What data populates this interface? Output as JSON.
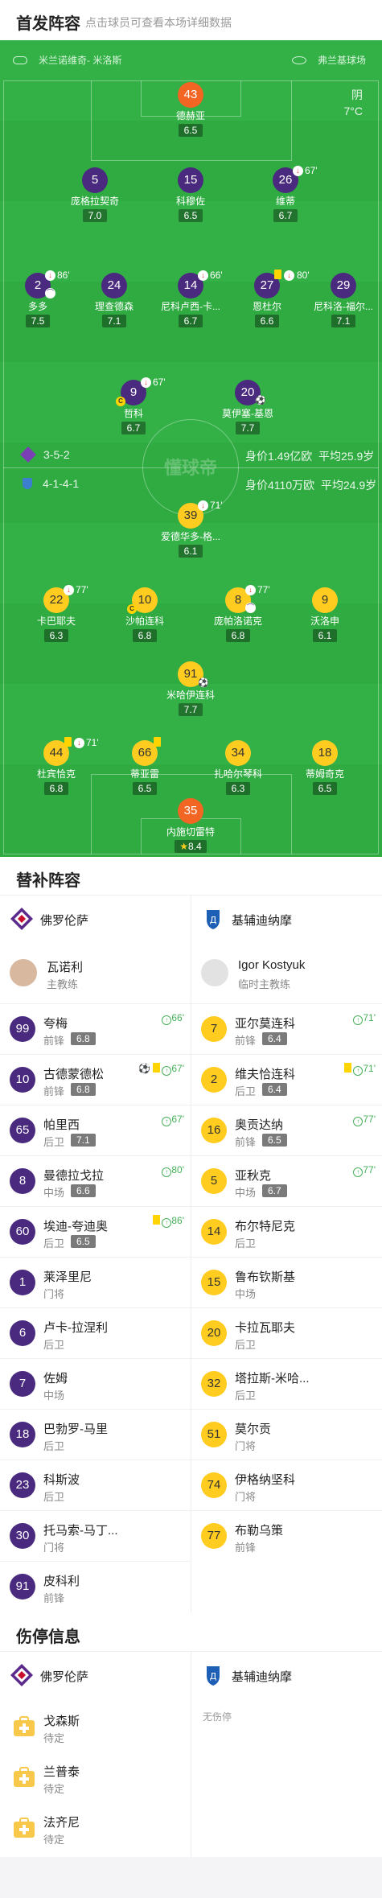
{
  "header": {
    "title": "首发阵容",
    "subtitle": "点击球员可查看本场详细数据"
  },
  "venue": {
    "home_team": "米兰诺维奇- 米洛斯",
    "stadium": "弗兰基球场"
  },
  "weather": {
    "condition": "阴",
    "temp": "7°C"
  },
  "watermark": "懂球帝",
  "home_formation": {
    "formation": "3-5-2",
    "value": "身价1.49亿欧",
    "age": "平均25.9岁"
  },
  "away_formation": {
    "formation": "4-1-4-1",
    "value": "身价4110万欧",
    "age": "平均24.9岁"
  },
  "home_players": [
    {
      "num": "43",
      "name": "德赫亚",
      "rating": "6.5",
      "gk": true
    },
    {
      "num": "5",
      "name": "庞格拉契奇",
      "rating": "7.0"
    },
    {
      "num": "15",
      "name": "科穆佐",
      "rating": "6.5"
    },
    {
      "num": "26",
      "name": "维蒂",
      "rating": "6.7",
      "sub": "67'"
    },
    {
      "num": "2",
      "name": "多多",
      "rating": "7.5",
      "sub": "86'"
    },
    {
      "num": "24",
      "name": "理查德森",
      "rating": "7.1"
    },
    {
      "num": "14",
      "name": "尼科卢西-卡...",
      "rating": "6.7",
      "sub": "66'"
    },
    {
      "num": "27",
      "name": "恩杜尔",
      "rating": "6.6",
      "sub": "80'"
    },
    {
      "num": "29",
      "name": "尼科洛-福尔...",
      "rating": "7.1"
    },
    {
      "num": "9",
      "name": "哲科",
      "rating": "6.7",
      "sub": "67'"
    },
    {
      "num": "20",
      "name": "莫伊塞-基恩",
      "rating": "7.7"
    }
  ],
  "away_players": [
    {
      "num": "39",
      "name": "爱德华多-格...",
      "rating": "6.1",
      "sub": "71'"
    },
    {
      "num": "22",
      "name": "卡巴耶夫",
      "rating": "6.3",
      "sub": "77'"
    },
    {
      "num": "10",
      "name": "沙帕连科",
      "rating": "6.8"
    },
    {
      "num": "8",
      "name": "庞帕洛诺克",
      "rating": "6.8",
      "sub": "77'"
    },
    {
      "num": "9",
      "name": "沃洛申",
      "rating": "6.1"
    },
    {
      "num": "91",
      "name": "米哈伊连科",
      "rating": "7.7"
    },
    {
      "num": "44",
      "name": "杜宾恰克",
      "rating": "6.8",
      "sub": "71'"
    },
    {
      "num": "66",
      "name": "蒂亚雷",
      "rating": "6.5"
    },
    {
      "num": "34",
      "name": "扎哈尔琴科",
      "rating": "6.3"
    },
    {
      "num": "18",
      "name": "蒂姆奇克",
      "rating": "6.5"
    },
    {
      "num": "35",
      "name": "内施切雷特",
      "rating": "8.4"
    }
  ],
  "subs_section": {
    "title": "替补阵容"
  },
  "teams": {
    "home": "佛罗伦萨",
    "away": "基辅迪纳摩"
  },
  "coaches": {
    "home": {
      "name": "瓦诺利",
      "role": "主教练"
    },
    "away": {
      "name": "Igor Kostyuk",
      "role": "临时主教练"
    }
  },
  "home_subs": [
    {
      "num": "99",
      "name": "夸梅",
      "pos": "前锋",
      "rating": "6.8",
      "event": "66'"
    },
    {
      "num": "10",
      "name": "古德蒙德松",
      "pos": "前锋",
      "rating": "6.8",
      "event": "67'"
    },
    {
      "num": "65",
      "name": "帕里西",
      "pos": "后卫",
      "rating": "7.1",
      "event": "67'"
    },
    {
      "num": "8",
      "name": "曼德拉戈拉",
      "pos": "中场",
      "rating": "6.6",
      "event": "80'"
    },
    {
      "num": "60",
      "name": "埃迪-夸迪奥",
      "pos": "后卫",
      "rating": "6.5",
      "event": "86'"
    },
    {
      "num": "1",
      "name": "莱泽里尼",
      "pos": "门将"
    },
    {
      "num": "6",
      "name": "卢卡-拉涅利",
      "pos": "后卫"
    },
    {
      "num": "7",
      "name": "佐姆",
      "pos": "中场"
    },
    {
      "num": "18",
      "name": "巴勃罗-马里",
      "pos": "后卫"
    },
    {
      "num": "23",
      "name": "科斯波",
      "pos": "后卫"
    },
    {
      "num": "30",
      "name": "托马索-马丁...",
      "pos": "门将"
    },
    {
      "num": "91",
      "name": "皮科利",
      "pos": "前锋"
    }
  ],
  "away_subs": [
    {
      "num": "7",
      "name": "亚尔莫连科",
      "pos": "前锋",
      "rating": "6.4",
      "event": "71'"
    },
    {
      "num": "2",
      "name": "维夫恰连科",
      "pos": "后卫",
      "rating": "6.4",
      "event": "71'"
    },
    {
      "num": "16",
      "name": "奥贡达纳",
      "pos": "前锋",
      "rating": "6.5",
      "event": "77'"
    },
    {
      "num": "5",
      "name": "亚秋克",
      "pos": "中场",
      "rating": "6.7",
      "event": "77'"
    },
    {
      "num": "14",
      "name": "布尔特尼克",
      "pos": "后卫"
    },
    {
      "num": "15",
      "name": "鲁布钦斯基",
      "pos": "中场"
    },
    {
      "num": "20",
      "name": "卡拉瓦耶夫",
      "pos": "后卫"
    },
    {
      "num": "32",
      "name": "塔拉斯-米哈...",
      "pos": "后卫"
    },
    {
      "num": "51",
      "name": "莫尔贡",
      "pos": "门将"
    },
    {
      "num": "74",
      "name": "伊格纳坚科",
      "pos": "门将"
    },
    {
      "num": "77",
      "name": "布勒乌策",
      "pos": "前锋"
    }
  ],
  "injury_section": {
    "title": "伤停信息"
  },
  "injuries_home": [
    {
      "name": "戈森斯",
      "status": "待定"
    },
    {
      "name": "兰普泰",
      "status": "待定"
    },
    {
      "name": "法齐尼",
      "status": "待定"
    }
  ],
  "injuries_away_empty": "无伤停",
  "colors": {
    "home": "#4a2a7f",
    "away": "#ffcc1f",
    "gk": "#f26522",
    "pitch": "#2fab41",
    "sub_green": "#46b05a"
  }
}
